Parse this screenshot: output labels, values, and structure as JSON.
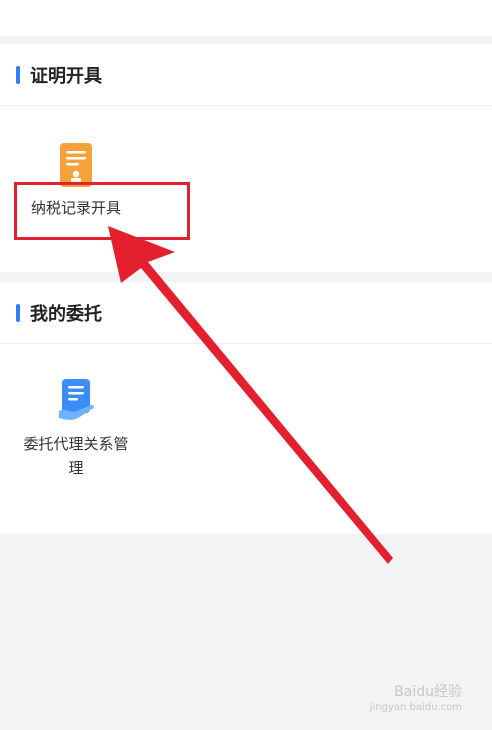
{
  "sections": [
    {
      "title": "证明开具",
      "items": [
        {
          "label": "纳税记录开具",
          "icon": "certificate-icon"
        }
      ]
    },
    {
      "title": "我的委托",
      "items": [
        {
          "label": "委托代理关系管理",
          "icon": "delegation-document-icon"
        }
      ]
    }
  ],
  "watermark": {
    "brand": "Baidu经验",
    "url": "jingyan.baidu.com"
  },
  "colors": {
    "accent": "#2f7ef5",
    "annotation_red": "#e5202e",
    "certificate_orange": "#f5a23a",
    "document_blue": "#3a8df5"
  }
}
